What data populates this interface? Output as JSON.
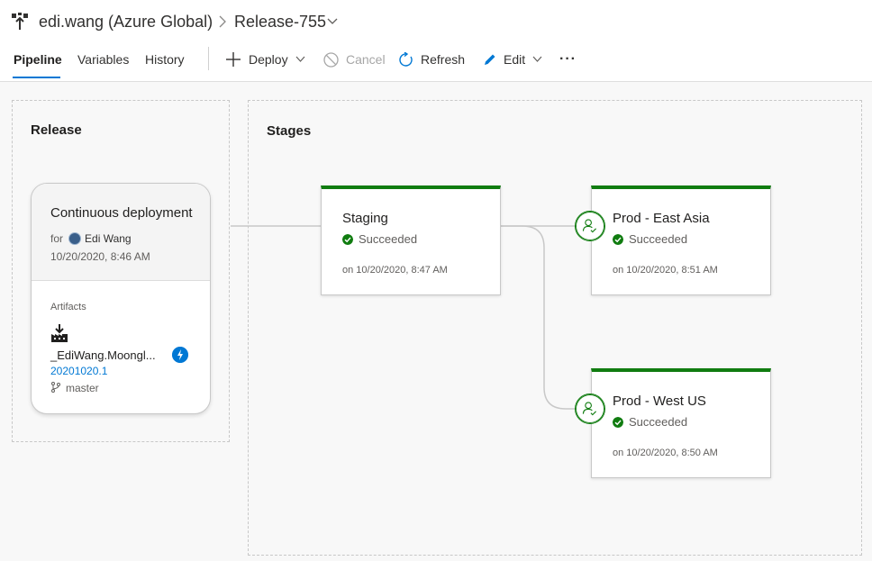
{
  "header": {
    "org": "edi.wang (Azure Global)",
    "release": "Release-755"
  },
  "tabs": {
    "pipeline": "Pipeline",
    "variables": "Variables",
    "history": "History"
  },
  "toolbar": {
    "deploy": "Deploy",
    "cancel": "Cancel",
    "refresh": "Refresh",
    "edit": "Edit",
    "more": "···"
  },
  "release_panel": {
    "title": "Release",
    "trigger": "Continuous deployment",
    "for_label": "for",
    "user": "Edi Wang",
    "date": "10/20/2020, 8:46 AM",
    "artifacts_label": "Artifacts",
    "artifact_name": "_EdiWang.Moongl...",
    "artifact_version": "20201020.1",
    "branch": "master"
  },
  "stages_panel": {
    "title": "Stages",
    "stages": [
      {
        "name": "Staging",
        "status": "Succeeded",
        "time": "on 10/20/2020, 8:47 AM"
      },
      {
        "name": "Prod - East Asia",
        "status": "Succeeded",
        "time": "on 10/20/2020, 8:51 AM"
      },
      {
        "name": "Prod - West US",
        "status": "Succeeded",
        "time": "on 10/20/2020, 8:50 AM"
      }
    ]
  },
  "colors": {
    "accent": "#0078d4",
    "success": "#107c10"
  },
  "icons": [
    "release-pipeline-icon",
    "chevron-right-icon",
    "chevron-down-icon",
    "plus-icon",
    "cancel-icon",
    "refresh-icon",
    "edit-icon",
    "more-icon",
    "artifact-icon",
    "lightning-icon",
    "branch-icon",
    "check-icon",
    "approver-icon"
  ]
}
